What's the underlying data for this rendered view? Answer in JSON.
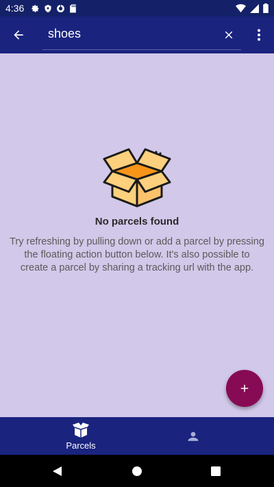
{
  "status_bar": {
    "time": "4:36",
    "left_icons": [
      "gear-icon",
      "shield-icon",
      "vpn-icon",
      "sd-card-icon"
    ],
    "right_icons": [
      "wifi-icon",
      "signal-icon",
      "battery-icon"
    ]
  },
  "app_bar": {
    "search_value": "shoes",
    "back_icon": "arrow-back-icon",
    "clear_icon": "close-icon",
    "more_icon": "more-vert-icon"
  },
  "empty_state": {
    "title": "No parcels found",
    "description": "Try refreshing by pulling down or add a parcel by pressing the floating action button below. It's also possible to create a parcel by sharing a tracking url with the app."
  },
  "fab": {
    "icon": "plus-icon"
  },
  "bottom_nav": {
    "items": [
      {
        "label": "Parcels",
        "icon": "parcel-icon",
        "selected": true
      },
      {
        "label": "",
        "icon": "person-icon",
        "selected": false
      }
    ]
  },
  "system_nav": {
    "buttons": [
      "back-triangle-icon",
      "home-circle-icon",
      "recents-square-icon"
    ]
  },
  "colors": {
    "primary": "#1a237e",
    "background": "#d2c8e9",
    "fab": "#870a55",
    "box_orange": "#f7a23b",
    "box_light": "#fdd07d"
  }
}
